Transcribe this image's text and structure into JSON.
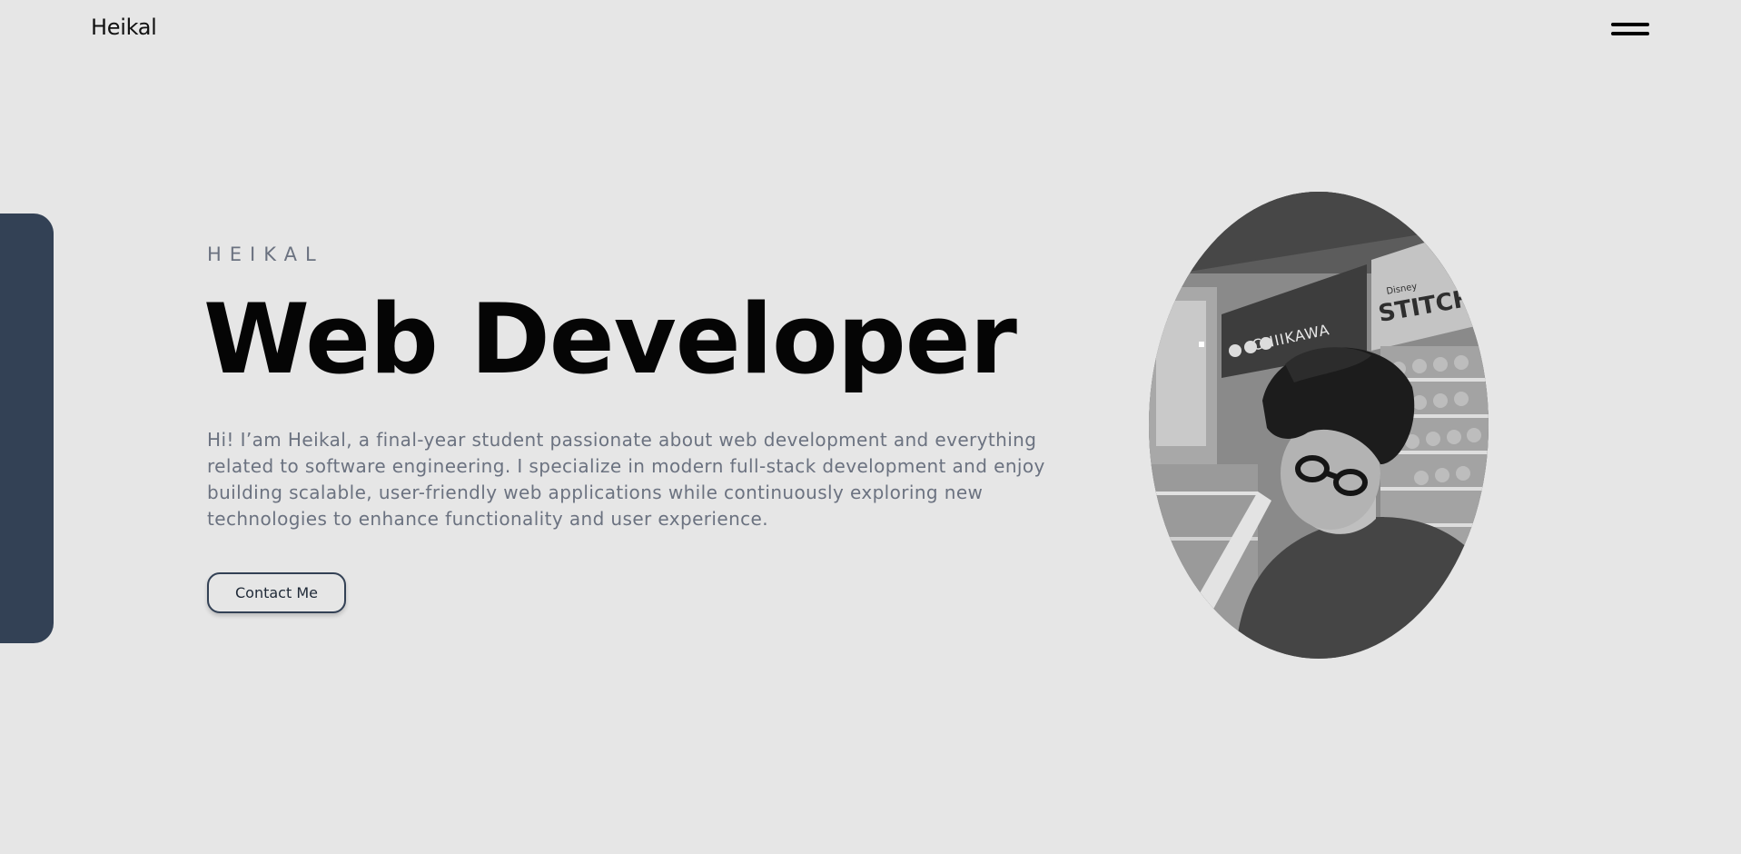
{
  "header": {
    "logo": "Heikal",
    "menu_icon": "hamburger-menu-icon"
  },
  "hero": {
    "eyebrow": "HEIKAL",
    "title": "Web Developer",
    "intro": "Hi! I’am Heikal, a final-year student passionate about web development and everything related to software engineering. I specialize in modern full-stack development and enjoy building scalable, user-friendly web applications while continuously exploring new technologies to enhance functionality and user experience.",
    "cta_label": "Contact Me"
  },
  "portrait": {
    "sign_left": "CHIIKAWA",
    "sign_right": "STITCH",
    "sign_right_small": "Disney"
  },
  "colors": {
    "background": "#e6e6e6",
    "accent": "#334155",
    "muted_text": "#6b7280",
    "heading": "#050505"
  }
}
